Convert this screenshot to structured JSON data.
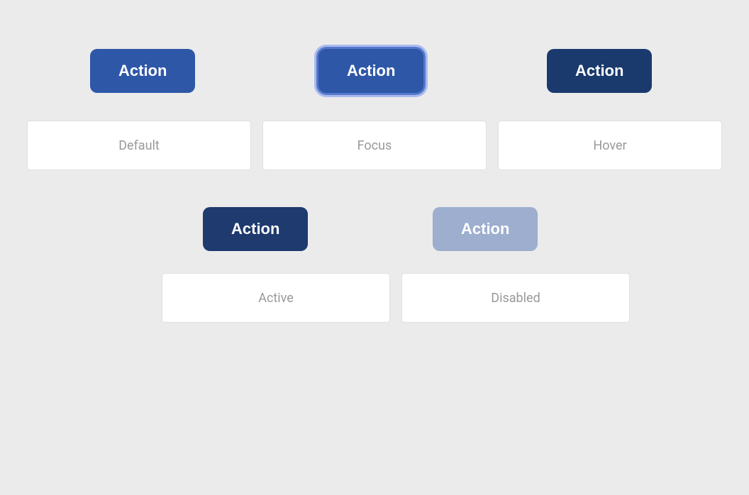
{
  "buttons": {
    "default": {
      "label": "Action",
      "state": "default"
    },
    "focus": {
      "label": "Action",
      "state": "focus"
    },
    "hover": {
      "label": "Action",
      "state": "hover"
    },
    "active": {
      "label": "Action",
      "state": "active"
    },
    "disabled": {
      "label": "Action",
      "state": "disabled"
    }
  },
  "labels": {
    "default": "Default",
    "focus": "Focus",
    "hover": "Hover",
    "active": "Active",
    "disabled": "Disabled"
  },
  "colors": {
    "primary": "#2e57a8",
    "primary_dark": "#1e3a6e",
    "primary_disabled": "#9daece",
    "white": "#ffffff",
    "background": "#ebebeb"
  }
}
